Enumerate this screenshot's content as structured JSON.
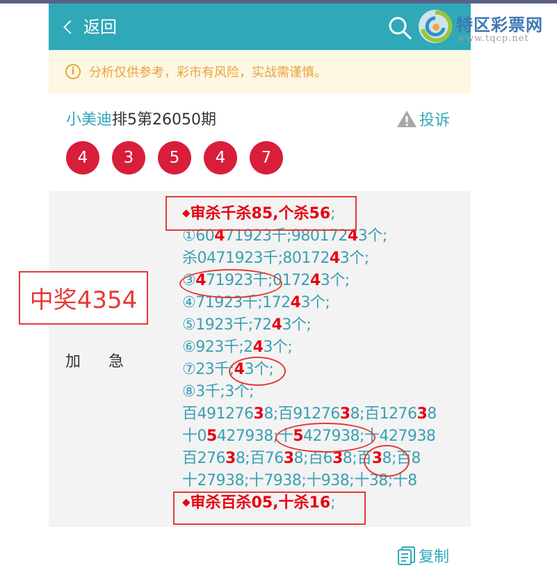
{
  "header": {
    "back_label": "返回"
  },
  "logo": {
    "name": "特区彩票网",
    "url": "www.tqcp.net"
  },
  "notice": {
    "text": "分析仅供参考，彩市有风险，实战需谨慎。"
  },
  "post": {
    "author": "小美迪",
    "title_rest": "排5第26050期",
    "complaint_label": "投诉",
    "balls": [
      "4",
      "3",
      "5",
      "4",
      "7"
    ]
  },
  "content": {
    "label": "加急",
    "lines": [
      [
        {
          "t": "◆",
          "c": "diamond"
        },
        {
          "t": "审杀千杀85,个杀56"
        },
        {
          "t": ";",
          "c": "pun"
        }
      ],
      [
        {
          "t": "①60"
        },
        {
          "t": "4",
          "h": true
        },
        {
          "t": "71923千;980172"
        },
        {
          "t": "4",
          "h": true
        },
        {
          "t": "3个;"
        }
      ],
      [
        {
          "t": "杀0471923千;80172"
        },
        {
          "t": "4",
          "h": true
        },
        {
          "t": "3个;"
        }
      ],
      [
        {
          "t": "③"
        },
        {
          "t": "4",
          "h": true
        },
        {
          "t": "71923千;0172"
        },
        {
          "t": "4",
          "h": true
        },
        {
          "t": "3个;"
        }
      ],
      [
        {
          "t": "④71923千;172"
        },
        {
          "t": "4",
          "h": true
        },
        {
          "t": "3个;"
        }
      ],
      [
        {
          "t": "⑤1923千;72"
        },
        {
          "t": "4",
          "h": true
        },
        {
          "t": "3个;"
        }
      ],
      [
        {
          "t": "⑥923千;2"
        },
        {
          "t": "4",
          "h": true
        },
        {
          "t": "3个;"
        }
      ],
      [
        {
          "t": "⑦23千;"
        },
        {
          "t": "4",
          "h": true
        },
        {
          "t": "3个;"
        }
      ],
      [
        {
          "t": "⑧3千;3个;"
        }
      ],
      [
        {
          "t": "百49127"
        },
        {
          "t": "6",
          "h": false
        },
        {
          "t": "3",
          "h": true
        },
        {
          "t": "8;百91276"
        },
        {
          "t": "3",
          "h": true
        },
        {
          "t": "8;百127"
        },
        {
          "t": "6",
          "h": false
        },
        {
          "t": "3",
          "h": true
        },
        {
          "t": "8"
        }
      ],
      [
        {
          "t": "十0"
        },
        {
          "t": "5",
          "h": true
        },
        {
          "t": "427938;十"
        },
        {
          "t": "5",
          "h": true
        },
        {
          "t": "427938;十427938"
        }
      ],
      [
        {
          "t": "百276"
        },
        {
          "t": "3",
          "h": true
        },
        {
          "t": "8;百76"
        },
        {
          "t": "3",
          "h": true
        },
        {
          "t": "8;百6"
        },
        {
          "t": "3",
          "h": true
        },
        {
          "t": "8;百"
        },
        {
          "t": "3",
          "h": true
        },
        {
          "t": "8;百8"
        }
      ],
      [
        {
          "t": "十27938;十7938;十938;十38;十8"
        }
      ],
      [
        {
          "t": "◆",
          "c": "diamond"
        },
        {
          "t": "审杀百杀05,十杀16"
        },
        {
          "t": ";",
          "c": "pun"
        }
      ]
    ]
  },
  "annotation": {
    "prize": "中奖4354"
  },
  "footer": {
    "copy_label": "复制"
  },
  "colors": {
    "teal": "#2fa8b8",
    "red": "#e60012",
    "ball": "#d81e3a",
    "notice_bg": "#fdf7e3",
    "notice_fg": "#e9a33b"
  }
}
